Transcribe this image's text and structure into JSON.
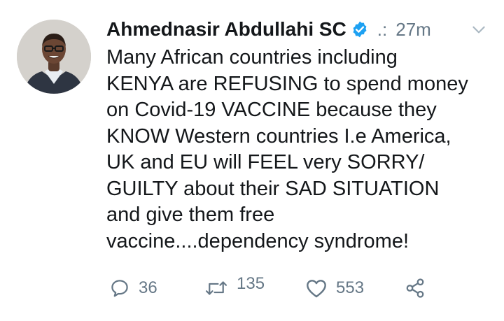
{
  "tweet": {
    "author": {
      "name": "Ahmednasir Abdullahi SC",
      "handle": ".:",
      "verified": true
    },
    "separator": "",
    "time": "27m",
    "text": "Many African countries including\nKENYA are REFUSING to spend money\non Covid-19 VACCINE because they\nKNOW Western countries I.e America,\nUK and EU will FEEL very SORRY/\nGUILTY about their SAD SITUATION\nand give them free\nvaccine....dependency syndrome!",
    "actions": {
      "replies": "36",
      "retweets": "135",
      "likes": "553"
    }
  },
  "colors": {
    "text": "#14171a",
    "secondary": "#657786",
    "verified_badge": "#1da1f2"
  },
  "icons": {
    "verified": "verified-badge-icon",
    "more": "chevron-down-icon",
    "reply": "reply-icon",
    "retweet": "retweet-icon",
    "like": "heart-icon",
    "share": "share-icon"
  }
}
